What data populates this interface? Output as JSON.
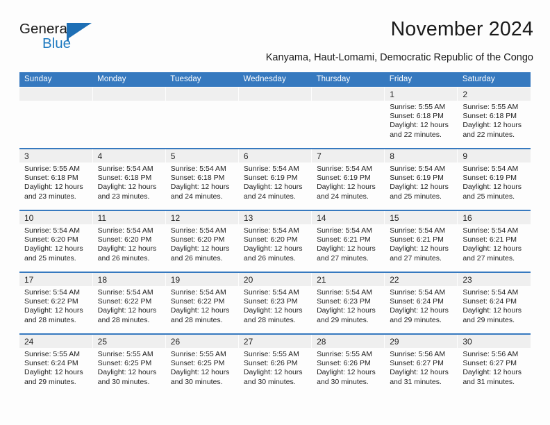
{
  "brand": {
    "name_part1": "General",
    "name_part2": "Blue",
    "accent_color": "#1e6fb5"
  },
  "header": {
    "month_title": "November 2024",
    "location": "Kanyama, Haut-Lomami, Democratic Republic of the Congo"
  },
  "calendar": {
    "header_bg": "#3679bf",
    "daynum_bg": "#efefef",
    "weekdays": [
      "Sunday",
      "Monday",
      "Tuesday",
      "Wednesday",
      "Thursday",
      "Friday",
      "Saturday"
    ],
    "weeks": [
      [
        {
          "day": "",
          "sunrise": "",
          "sunset": "",
          "daylight": ""
        },
        {
          "day": "",
          "sunrise": "",
          "sunset": "",
          "daylight": ""
        },
        {
          "day": "",
          "sunrise": "",
          "sunset": "",
          "daylight": ""
        },
        {
          "day": "",
          "sunrise": "",
          "sunset": "",
          "daylight": ""
        },
        {
          "day": "",
          "sunrise": "",
          "sunset": "",
          "daylight": ""
        },
        {
          "day": "1",
          "sunrise": "Sunrise: 5:55 AM",
          "sunset": "Sunset: 6:18 PM",
          "daylight": "Daylight: 12 hours and 22 minutes."
        },
        {
          "day": "2",
          "sunrise": "Sunrise: 5:55 AM",
          "sunset": "Sunset: 6:18 PM",
          "daylight": "Daylight: 12 hours and 22 minutes."
        }
      ],
      [
        {
          "day": "3",
          "sunrise": "Sunrise: 5:55 AM",
          "sunset": "Sunset: 6:18 PM",
          "daylight": "Daylight: 12 hours and 23 minutes."
        },
        {
          "day": "4",
          "sunrise": "Sunrise: 5:54 AM",
          "sunset": "Sunset: 6:18 PM",
          "daylight": "Daylight: 12 hours and 23 minutes."
        },
        {
          "day": "5",
          "sunrise": "Sunrise: 5:54 AM",
          "sunset": "Sunset: 6:18 PM",
          "daylight": "Daylight: 12 hours and 24 minutes."
        },
        {
          "day": "6",
          "sunrise": "Sunrise: 5:54 AM",
          "sunset": "Sunset: 6:19 PM",
          "daylight": "Daylight: 12 hours and 24 minutes."
        },
        {
          "day": "7",
          "sunrise": "Sunrise: 5:54 AM",
          "sunset": "Sunset: 6:19 PM",
          "daylight": "Daylight: 12 hours and 24 minutes."
        },
        {
          "day": "8",
          "sunrise": "Sunrise: 5:54 AM",
          "sunset": "Sunset: 6:19 PM",
          "daylight": "Daylight: 12 hours and 25 minutes."
        },
        {
          "day": "9",
          "sunrise": "Sunrise: 5:54 AM",
          "sunset": "Sunset: 6:19 PM",
          "daylight": "Daylight: 12 hours and 25 minutes."
        }
      ],
      [
        {
          "day": "10",
          "sunrise": "Sunrise: 5:54 AM",
          "sunset": "Sunset: 6:20 PM",
          "daylight": "Daylight: 12 hours and 25 minutes."
        },
        {
          "day": "11",
          "sunrise": "Sunrise: 5:54 AM",
          "sunset": "Sunset: 6:20 PM",
          "daylight": "Daylight: 12 hours and 26 minutes."
        },
        {
          "day": "12",
          "sunrise": "Sunrise: 5:54 AM",
          "sunset": "Sunset: 6:20 PM",
          "daylight": "Daylight: 12 hours and 26 minutes."
        },
        {
          "day": "13",
          "sunrise": "Sunrise: 5:54 AM",
          "sunset": "Sunset: 6:20 PM",
          "daylight": "Daylight: 12 hours and 26 minutes."
        },
        {
          "day": "14",
          "sunrise": "Sunrise: 5:54 AM",
          "sunset": "Sunset: 6:21 PM",
          "daylight": "Daylight: 12 hours and 27 minutes."
        },
        {
          "day": "15",
          "sunrise": "Sunrise: 5:54 AM",
          "sunset": "Sunset: 6:21 PM",
          "daylight": "Daylight: 12 hours and 27 minutes."
        },
        {
          "day": "16",
          "sunrise": "Sunrise: 5:54 AM",
          "sunset": "Sunset: 6:21 PM",
          "daylight": "Daylight: 12 hours and 27 minutes."
        }
      ],
      [
        {
          "day": "17",
          "sunrise": "Sunrise: 5:54 AM",
          "sunset": "Sunset: 6:22 PM",
          "daylight": "Daylight: 12 hours and 28 minutes."
        },
        {
          "day": "18",
          "sunrise": "Sunrise: 5:54 AM",
          "sunset": "Sunset: 6:22 PM",
          "daylight": "Daylight: 12 hours and 28 minutes."
        },
        {
          "day": "19",
          "sunrise": "Sunrise: 5:54 AM",
          "sunset": "Sunset: 6:22 PM",
          "daylight": "Daylight: 12 hours and 28 minutes."
        },
        {
          "day": "20",
          "sunrise": "Sunrise: 5:54 AM",
          "sunset": "Sunset: 6:23 PM",
          "daylight": "Daylight: 12 hours and 28 minutes."
        },
        {
          "day": "21",
          "sunrise": "Sunrise: 5:54 AM",
          "sunset": "Sunset: 6:23 PM",
          "daylight": "Daylight: 12 hours and 29 minutes."
        },
        {
          "day": "22",
          "sunrise": "Sunrise: 5:54 AM",
          "sunset": "Sunset: 6:24 PM",
          "daylight": "Daylight: 12 hours and 29 minutes."
        },
        {
          "day": "23",
          "sunrise": "Sunrise: 5:54 AM",
          "sunset": "Sunset: 6:24 PM",
          "daylight": "Daylight: 12 hours and 29 minutes."
        }
      ],
      [
        {
          "day": "24",
          "sunrise": "Sunrise: 5:55 AM",
          "sunset": "Sunset: 6:24 PM",
          "daylight": "Daylight: 12 hours and 29 minutes."
        },
        {
          "day": "25",
          "sunrise": "Sunrise: 5:55 AM",
          "sunset": "Sunset: 6:25 PM",
          "daylight": "Daylight: 12 hours and 30 minutes."
        },
        {
          "day": "26",
          "sunrise": "Sunrise: 5:55 AM",
          "sunset": "Sunset: 6:25 PM",
          "daylight": "Daylight: 12 hours and 30 minutes."
        },
        {
          "day": "27",
          "sunrise": "Sunrise: 5:55 AM",
          "sunset": "Sunset: 6:26 PM",
          "daylight": "Daylight: 12 hours and 30 minutes."
        },
        {
          "day": "28",
          "sunrise": "Sunrise: 5:55 AM",
          "sunset": "Sunset: 6:26 PM",
          "daylight": "Daylight: 12 hours and 30 minutes."
        },
        {
          "day": "29",
          "sunrise": "Sunrise: 5:56 AM",
          "sunset": "Sunset: 6:27 PM",
          "daylight": "Daylight: 12 hours and 31 minutes."
        },
        {
          "day": "30",
          "sunrise": "Sunrise: 5:56 AM",
          "sunset": "Sunset: 6:27 PM",
          "daylight": "Daylight: 12 hours and 31 minutes."
        }
      ]
    ]
  }
}
